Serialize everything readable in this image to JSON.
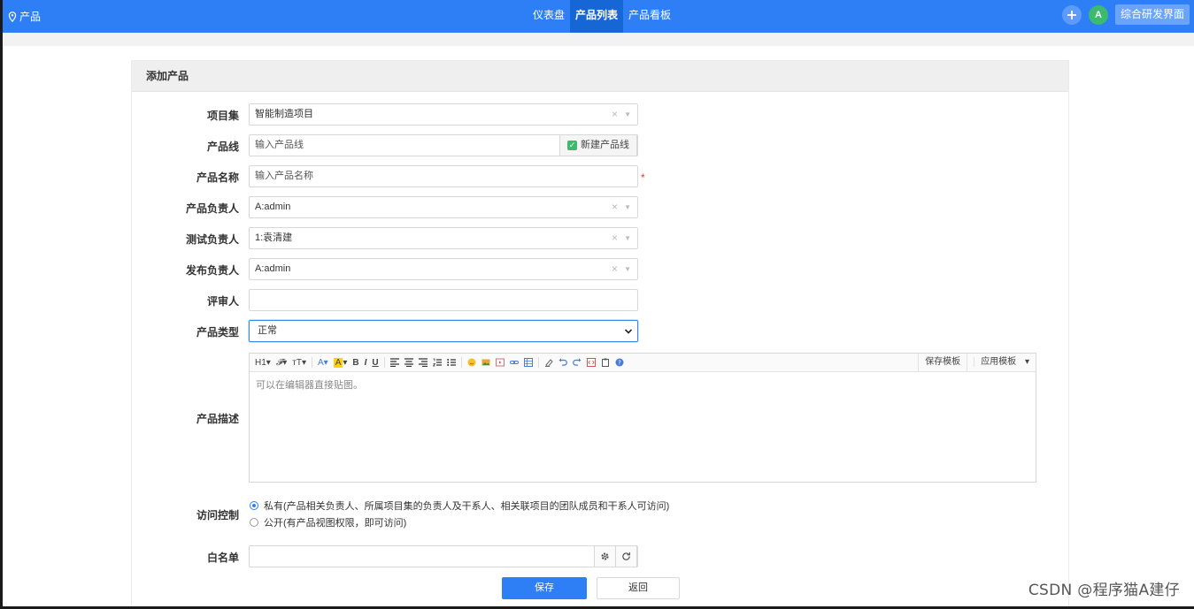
{
  "topbar": {
    "brand_label": "产品",
    "nav": [
      {
        "label": "仪表盘",
        "active": false
      },
      {
        "label": "产品列表",
        "active": true
      },
      {
        "label": "产品看板",
        "active": false
      }
    ],
    "avatar_initial": "A",
    "switch_label": "综合研发界面"
  },
  "panel": {
    "title": "添加产品"
  },
  "form": {
    "program": {
      "label": "项目集",
      "value": "智能制造项目"
    },
    "line": {
      "label": "产品线",
      "placeholder": "输入产品线",
      "new_line_label": "新建产品线"
    },
    "name": {
      "label": "产品名称",
      "placeholder": "输入产品名称",
      "required_mark": "*"
    },
    "po": {
      "label": "产品负责人",
      "value": "A:admin"
    },
    "qd": {
      "label": "测试负责人",
      "value": "1:袁清建"
    },
    "rd": {
      "label": "发布负责人",
      "value": "A:admin"
    },
    "reviewer": {
      "label": "评审人",
      "value": ""
    },
    "type": {
      "label": "产品类型",
      "value": "正常",
      "options": [
        "正常"
      ]
    },
    "desc": {
      "label": "产品描述",
      "placeholder": "可以在编辑器直接贴图。",
      "toolbar": {
        "heading": "H1",
        "font": "𝓕",
        "size": "тT",
        "font_color": "A",
        "bg_color": "A",
        "bold": "B",
        "italic": "I",
        "underline": "U"
      },
      "save_template": "保存模板",
      "apply_template": "应用模板"
    },
    "acl": {
      "label": "访问控制",
      "options": [
        {
          "label": "私有(产品相关负责人、所属项目集的负责人及干系人、相关联项目的团队成员和干系人可访问)",
          "checked": true
        },
        {
          "label": "公开(有产品视图权限，即可访问)",
          "checked": false
        }
      ]
    },
    "whitelist": {
      "label": "白名单",
      "value": ""
    }
  },
  "actions": {
    "save": "保存",
    "back": "返回"
  },
  "watermark": "CSDN @程序猫A建仔",
  "colors": {
    "primary": "#2e7ff6",
    "success": "#3dba6e"
  }
}
